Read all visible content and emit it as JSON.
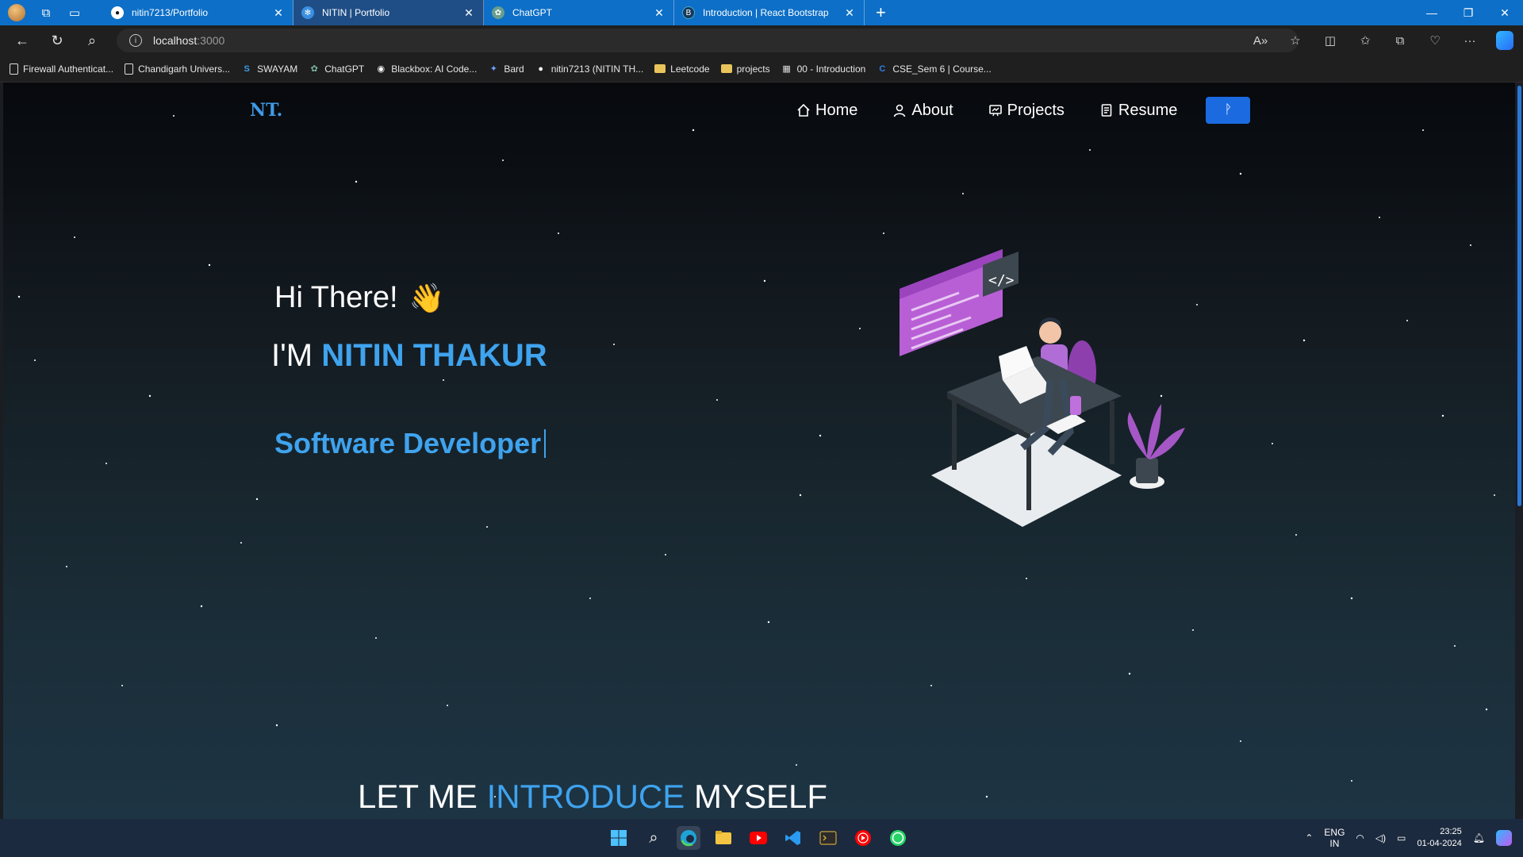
{
  "browser": {
    "tabs": [
      {
        "title": "nitin7213/Portfolio",
        "icon": "github-icon",
        "active": false
      },
      {
        "title": "NITIN | Portfolio",
        "icon": "react-icon",
        "active": true
      },
      {
        "title": "ChatGPT",
        "icon": "chatgpt-icon",
        "active": false
      },
      {
        "title": "Introduction | React Bootstrap",
        "icon": "react-bootstrap-icon",
        "active": false
      }
    ],
    "address": {
      "host": "localhost",
      "port": ":3000"
    },
    "bookmarks": [
      {
        "label": "Firewall Authenticat...",
        "icon": "page"
      },
      {
        "label": "Chandigarh Univers...",
        "icon": "page"
      },
      {
        "label": "SWAYAM",
        "icon": "swayam"
      },
      {
        "label": "ChatGPT",
        "icon": "chatgpt"
      },
      {
        "label": "Blackbox: AI Code...",
        "icon": "blackbox"
      },
      {
        "label": "Bard",
        "icon": "bard"
      },
      {
        "label": "nitin7213 (NITIN TH...",
        "icon": "github"
      },
      {
        "label": "Leetcode",
        "icon": "folder"
      },
      {
        "label": "projects",
        "icon": "folder"
      },
      {
        "label": "00 - Introduction",
        "icon": "notion"
      },
      {
        "label": "CSE_Sem 6 | Course...",
        "icon": "course"
      }
    ]
  },
  "site": {
    "logo": "NT.",
    "nav": [
      {
        "label": "Home",
        "icon": "home-icon"
      },
      {
        "label": "About",
        "icon": "user-icon"
      },
      {
        "label": "Projects",
        "icon": "projects-icon"
      },
      {
        "label": "Resume",
        "icon": "document-icon"
      }
    ],
    "github_button_glyph": "ᚹ",
    "hero": {
      "greeting": "Hi There!",
      "wave": "👋",
      "name_prefix": "I'M ",
      "name": "NITIN THAKUR",
      "role": "Software Developer"
    },
    "intro": {
      "part1": "LET ME ",
      "part2": "INTRODUCE",
      "part3": " MYSELF"
    }
  },
  "taskbar": {
    "apps": [
      "windows-start",
      "search",
      "edge",
      "file-explorer",
      "youtube",
      "vscode",
      "terminal",
      "youtube-music",
      "whatsapp"
    ],
    "lang_top": "ENG",
    "lang_bottom": "IN",
    "time": "23:25",
    "date": "01-04-2024"
  },
  "colors": {
    "accent": "#3fa3ee",
    "button": "#1b6ae0",
    "tab_bar": "#0d6fc7",
    "taskbar": "#1c2a3f"
  }
}
